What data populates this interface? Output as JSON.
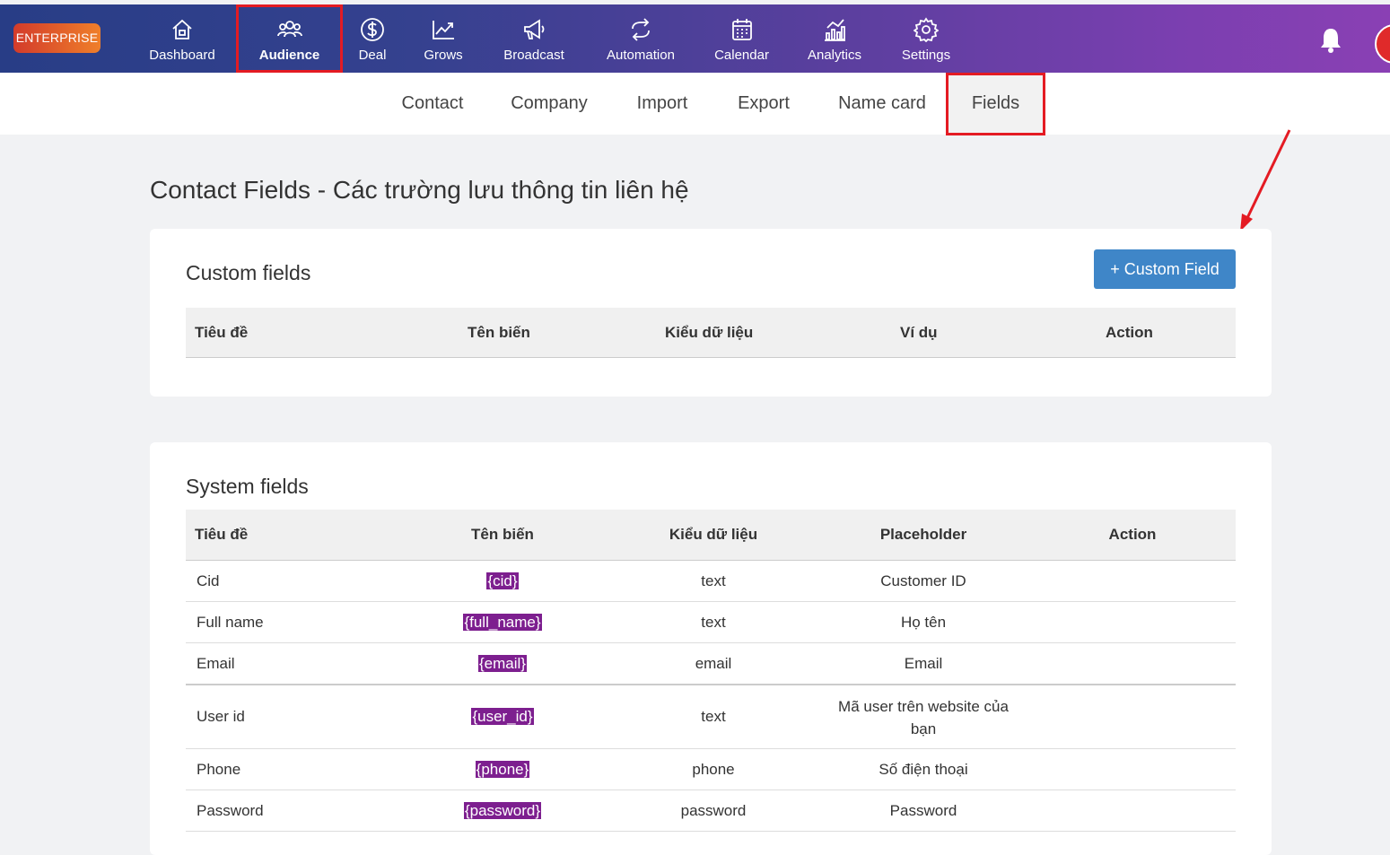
{
  "topbar": {
    "brand": "ENTERPRISE",
    "nav": [
      {
        "label": "Dashboard",
        "icon": "home-icon"
      },
      {
        "label": "Audience",
        "icon": "users-icon",
        "active": true
      },
      {
        "label": "Deal",
        "icon": "dollar-icon"
      },
      {
        "label": "Grows",
        "icon": "chart-up-icon"
      },
      {
        "label": "Broadcast",
        "icon": "megaphone-icon"
      },
      {
        "label": "Automation",
        "icon": "refresh-icon"
      },
      {
        "label": "Calendar",
        "icon": "calendar-icon"
      },
      {
        "label": "Analytics",
        "icon": "analytics-icon"
      },
      {
        "label": "Settings",
        "icon": "gear-icon"
      }
    ],
    "gradient_start": "#283d86",
    "gradient_end": "#8a40b4"
  },
  "subnav": {
    "tabs": [
      "Contact",
      "Company",
      "Import",
      "Export",
      "Name card",
      "Fields"
    ],
    "active": "Fields"
  },
  "page": {
    "title": "Contact Fields - Các trường lưu thông tin liên hệ"
  },
  "custom_fields": {
    "title": "Custom fields",
    "add_button": "+ Custom Field",
    "columns": [
      "Tiêu đề",
      "Tên biến",
      "Kiểu dữ liệu",
      "Ví dụ",
      "Action"
    ]
  },
  "system_fields": {
    "title": "System fields",
    "columns": [
      "Tiêu đề",
      "Tên biến",
      "Kiểu dữ liệu",
      "Placeholder",
      "Action"
    ],
    "rows": [
      {
        "title": "Cid",
        "var": "{cid}",
        "type": "text",
        "placeholder": "Customer ID"
      },
      {
        "title": "Full name",
        "var": "{full_name}",
        "type": "text",
        "placeholder": "Họ tên"
      },
      {
        "title": "Email",
        "var": "{email}",
        "type": "email",
        "placeholder": "Email"
      },
      {
        "title": "User id",
        "var": "{user_id}",
        "type": "text",
        "placeholder": "Mã user trên website của bạn"
      },
      {
        "title": "Phone",
        "var": "{phone}",
        "type": "phone",
        "placeholder": "Số điện thoại"
      },
      {
        "title": "Password",
        "var": "{password}",
        "type": "password",
        "placeholder": "Password"
      }
    ]
  },
  "colors": {
    "accent": "#3f86c8",
    "highlight": "#e41b23",
    "variable_bg": "#7d1f8f"
  }
}
